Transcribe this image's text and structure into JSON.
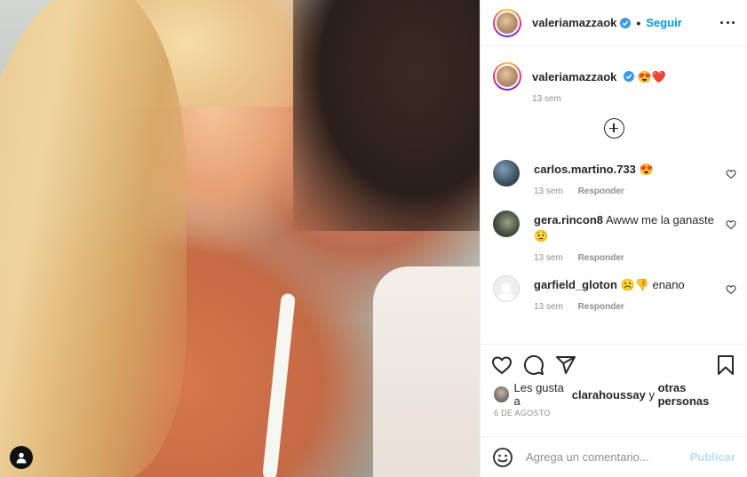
{
  "post": {
    "author": "valeriamazzaok",
    "follow_label": "Seguir",
    "separator": "•",
    "caption": {
      "username": "valeriamazzaok",
      "text": "😍❤️",
      "time": "13 sem"
    }
  },
  "comments": [
    {
      "username": "carlos.martino.733",
      "text": "😍",
      "time": "13 sem",
      "reply_label": "Responder"
    },
    {
      "username": "gera.rincon8",
      "text": "Awww me la ganaste 😟",
      "time": "13 sem",
      "reply_label": "Responder"
    },
    {
      "username": "garfield_gloton",
      "text": "☹️👎 enano",
      "time": "13 sem",
      "reply_label": "Responder"
    }
  ],
  "likes": {
    "prefix": "Les gusta a",
    "user": "clarahoussay",
    "connector": "y",
    "others": "otras personas"
  },
  "date": "6 DE AGOSTO",
  "add_comment": {
    "placeholder": "Agrega un comentario...",
    "post_label": "Publicar"
  },
  "icons": {
    "like": "heart-icon",
    "comment": "comment-icon",
    "share": "share-icon",
    "save": "bookmark-icon",
    "more": "more-options-icon",
    "emoji": "emoji-icon",
    "user_tag": "user-tag-icon",
    "verified": "verified-badge-icon",
    "load_more": "plus-circle-icon"
  },
  "colors": {
    "accent": "#0095f6",
    "verified": "#3897f0",
    "muted": "#8e8e8e",
    "post_disabled": "#b2dffc"
  }
}
